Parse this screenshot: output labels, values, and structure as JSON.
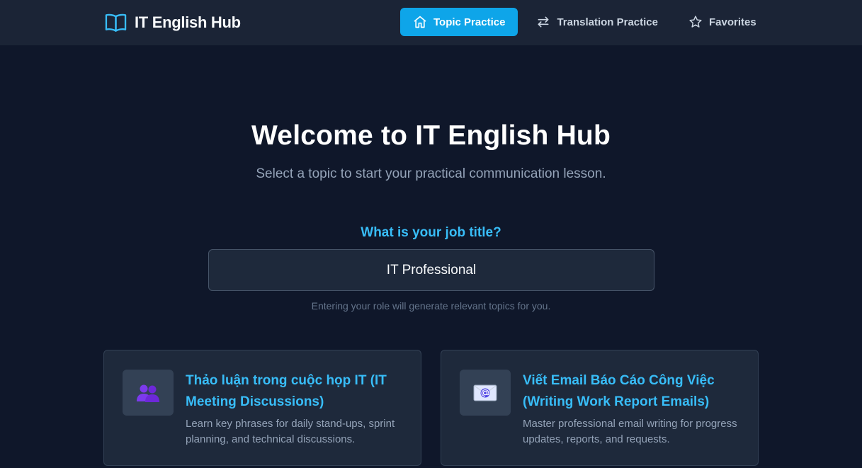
{
  "app": {
    "brand": "IT English Hub",
    "brand_icon": "open-book-icon"
  },
  "nav": {
    "items": [
      {
        "label": "Topic Practice",
        "icon": "home-icon",
        "active": true
      },
      {
        "label": "Translation Practice",
        "icon": "swap-arrows-icon",
        "active": false
      },
      {
        "label": "Favorites",
        "icon": "star-icon",
        "active": false
      }
    ]
  },
  "hero": {
    "title": "Welcome to IT English Hub",
    "subtitle": "Select a topic to start your practical communication lesson."
  },
  "job": {
    "label": "What is your job title?",
    "value": "IT Professional",
    "hint": "Entering your role will generate relevant topics for you."
  },
  "topics": [
    {
      "icon": "people-icon",
      "title": "Thảo luận trong cuộc họp IT (IT Meeting Discussions)",
      "description": "Learn key phrases for daily stand-ups, sprint planning, and technical discussions."
    },
    {
      "icon": "email-icon",
      "title": "Viết Email Báo Cáo Công Việc (Writing Work Report Emails)",
      "description": "Master professional email writing for progress updates, reports, and requests."
    }
  ],
  "colors": {
    "background": "#0f172a",
    "navbar": "#1b2436",
    "accent": "#0ea5e9",
    "heading_accent": "#38bdf8",
    "card": "#1e293b"
  }
}
